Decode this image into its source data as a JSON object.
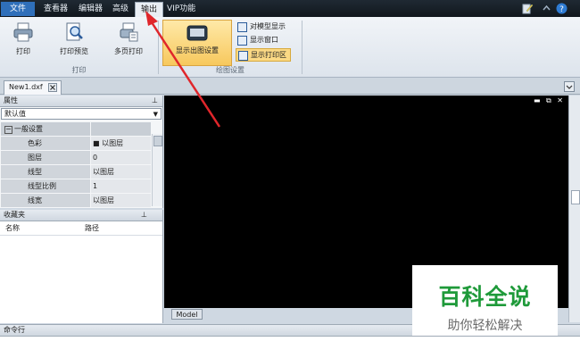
{
  "menubar": {
    "file": "文件",
    "tabs": [
      "查看器",
      "编辑器",
      "高级",
      "输出",
      "VIP功能"
    ],
    "active_tab": "输出"
  },
  "ribbon": {
    "print_group": {
      "label": "打印",
      "buttons": [
        "打印",
        "打印预览",
        "多页打印"
      ]
    },
    "drawing_group": {
      "label": "绘图设置",
      "big_button": "显示出图设置",
      "small_buttons": [
        "对模型显示",
        "显示窗口",
        "显示打印区"
      ]
    }
  },
  "document_tab": {
    "name": "New1.dxf"
  },
  "properties": {
    "title": "属性",
    "dropdown_value": "默认值",
    "section": "一般设置",
    "rows": [
      {
        "name": "色彩",
        "value": "■ 以图层"
      },
      {
        "name": "图层",
        "value": "0"
      },
      {
        "name": "线型",
        "value": "以图层"
      },
      {
        "name": "线型比例",
        "value": "1"
      },
      {
        "name": "线宽",
        "value": "以图层"
      }
    ]
  },
  "favorites": {
    "title": "收藏夹",
    "columns": [
      "名称",
      "路径"
    ]
  },
  "canvas": {
    "tab": "Model",
    "background": "#000000"
  },
  "command": {
    "title": "命令行"
  },
  "watermark": {
    "title": "百科全说",
    "subtitle": "助你轻松解决",
    "color": "#1f9a3a"
  },
  "colors": {
    "annotation_arrow": "#e0262b",
    "accent": "#2f6fba"
  }
}
